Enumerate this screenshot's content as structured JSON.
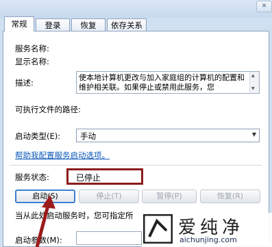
{
  "tabs": [
    "常规",
    "登录",
    "恢复",
    "依存关系"
  ],
  "labels": {
    "service_name": "服务名称:",
    "display_name": "显示名称:",
    "description": "描述:",
    "exe_path": "可执行文件的路径:",
    "startup_type": "启动类型(E):",
    "service_status": "服务状态:",
    "start_params": "启动参数(M):"
  },
  "description_text": "使本地计算机更改与加入家庭组的计算机的配置和维护相关联。如果停止或禁用此服务，您",
  "startup_type_value": "手动",
  "help_link": "帮助我配置服务启动选项。",
  "status_value": "已停止",
  "buttons": {
    "start": "启动(S)",
    "stop": "停止(T)",
    "pause": "暂停(P)",
    "resume": "恢复(R)"
  },
  "hint_text": "当从此处启动服务时，您可指定所",
  "watermark": {
    "brand": "爱纯净",
    "url": "aichunjing.com"
  },
  "colors": {
    "highlight_box": "#8b1a1a",
    "arrow": "#9b1b1b",
    "link": "#0b57b8"
  }
}
